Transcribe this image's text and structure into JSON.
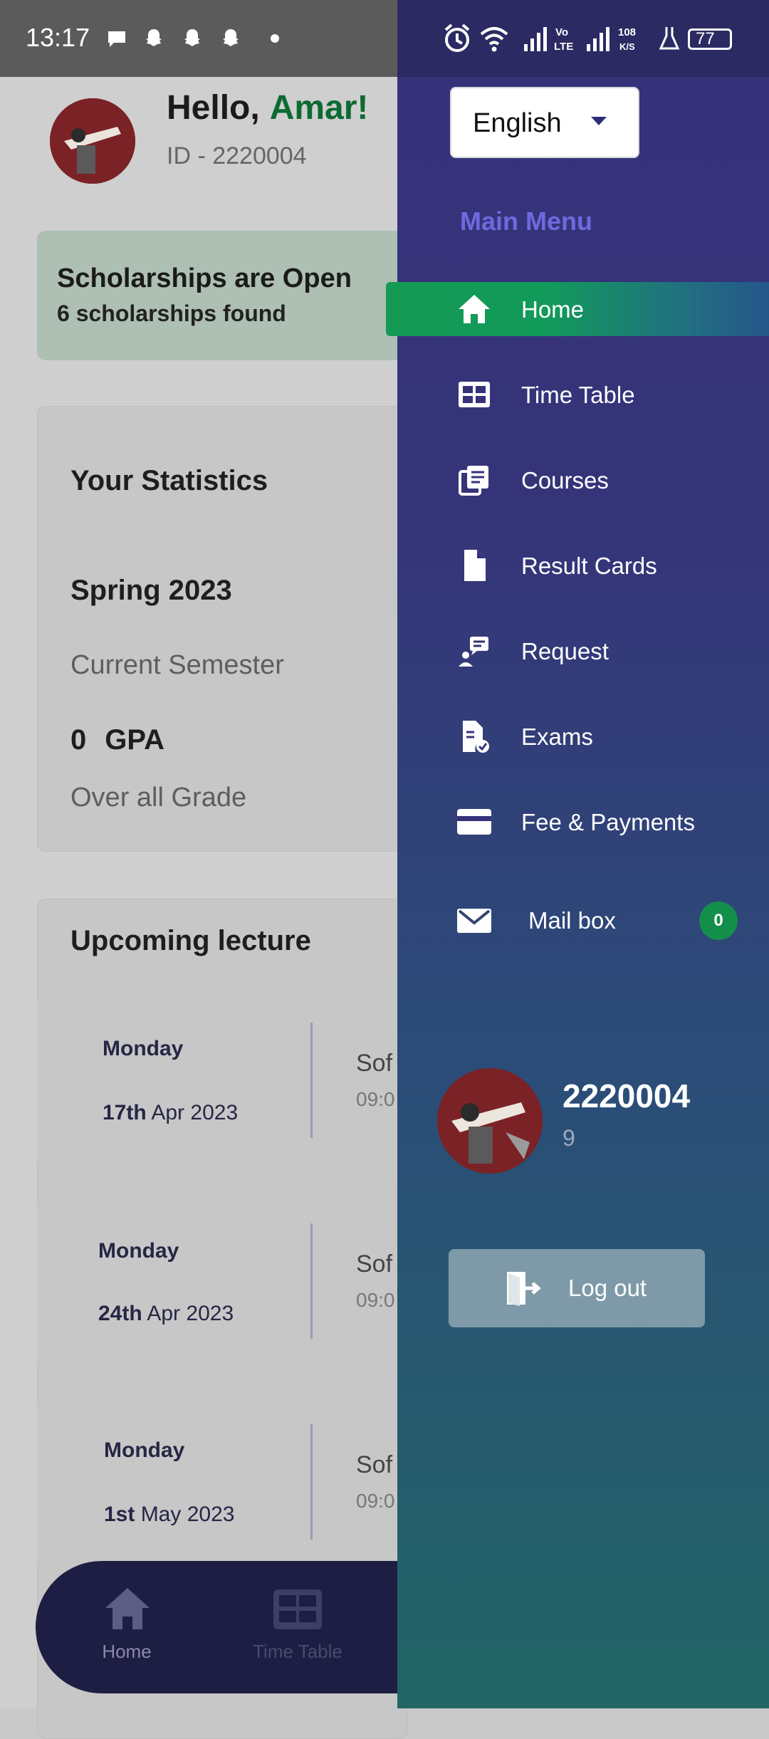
{
  "status_bar": {
    "time": "13:17",
    "network_speed": "108\nK/S",
    "volte": "Vo\nLTE",
    "battery": "77"
  },
  "header": {
    "greeting": "Hello,",
    "name": "Amar!",
    "id_text": "ID - 2220004"
  },
  "scholarship": {
    "title": "Scholarships are Open",
    "subtitle": "6 scholarships found"
  },
  "statistics": {
    "title": "Your Statistics",
    "semester": "Spring 2023",
    "current_label": "Current Semester",
    "gpa_value": "0",
    "gpa_label": "GPA",
    "grade_label": "Over all Grade"
  },
  "upcoming": {
    "title": "Upcoming lecture",
    "lectures": [
      {
        "day": "Monday",
        "date_bold": "17th",
        "date_rest": " Apr 2023",
        "subject": "Sof",
        "time": "09:0"
      },
      {
        "day": "Monday",
        "date_bold": "24th",
        "date_rest": " Apr 2023",
        "subject": "Sof",
        "time": "09:0"
      },
      {
        "day": "Monday",
        "date_bold": "1st",
        "date_rest": " May 2023",
        "subject": "Sof",
        "time": "09:0"
      }
    ]
  },
  "bottom_nav": {
    "items": [
      {
        "label": "Home",
        "icon": "home-icon"
      },
      {
        "label": "Time Table",
        "icon": "timetable-icon"
      }
    ]
  },
  "drawer": {
    "language": "English",
    "main_menu_label": "Main Menu",
    "menu": [
      {
        "label": "Home",
        "icon": "home-icon",
        "active": true
      },
      {
        "label": "Time Table",
        "icon": "timetable-icon"
      },
      {
        "label": "Courses",
        "icon": "courses-icon"
      },
      {
        "label": "Result Cards",
        "icon": "document-icon"
      },
      {
        "label": "Request",
        "icon": "request-icon"
      },
      {
        "label": "Exams",
        "icon": "exams-icon"
      },
      {
        "label": "Fee & Payments",
        "icon": "card-icon"
      },
      {
        "label": "Mail box",
        "icon": "mail-icon",
        "badge": "0"
      }
    ],
    "profile": {
      "id": "2220004",
      "subtitle": "9"
    },
    "logout_label": "Log out"
  },
  "colors": {
    "active_green": "#159a55",
    "accent_name": "#0d6a32",
    "drawer_top": "#35327a",
    "drawer_bottom": "#226666",
    "main_menu_label": "#6d6ae0"
  }
}
